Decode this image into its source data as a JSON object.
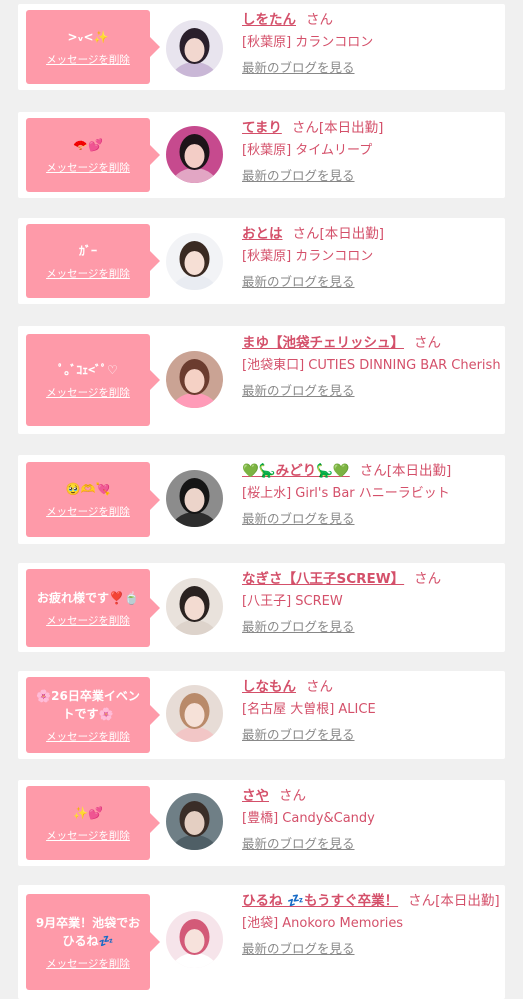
{
  "delete_label": "メッセージを削除",
  "blog_label": "最新のブログを見る",
  "colors": {
    "bubble": "#fe9aa9",
    "accent": "#d4506a",
    "background": "#f0f0f0"
  },
  "cards": [
    {
      "message": ">ᵥ<✨",
      "name": "しをたん",
      "suffix": "さん",
      "shop": "[秋葉原] カランコロン",
      "avatar": {
        "bg": "#e8e4ee",
        "hair": "#2a1f2b",
        "skin": "#f2d7cf",
        "cloth": "#c9b7d6"
      }
    },
    {
      "message": "🪭💕",
      "name": "てまり",
      "suffix": "さん[本日出勤]",
      "shop": "[秋葉原] タイムリープ",
      "avatar": {
        "bg": "#c64a8e",
        "hair": "#1d1419",
        "skin": "#f3cdc6",
        "cloth": "#e2a6c4"
      }
    },
    {
      "message": "ｶﾞｰ",
      "name": "おとは",
      "suffix": "さん[本日出勤]",
      "shop": "[秋葉原] カランコロン",
      "avatar": {
        "bg": "#f2f3f6",
        "hair": "#3a2a22",
        "skin": "#f6dfd5",
        "cloth": "#e9ecf2"
      }
    },
    {
      "message": "ﾟ｡ﾞｺｪ<ﾞﾟ♡",
      "name": "まゆ【池袋チェリッシュ】",
      "suffix": "さん",
      "shop": "[池袋東口] CUTIES DINNING BAR Cherish",
      "avatar": {
        "bg": "#caa394",
        "hair": "#6b3c2f",
        "skin": "#f5d1c5",
        "cloth": "#ff9bb8"
      }
    },
    {
      "message": "🥹🫶💘",
      "name": "💚🦕みどり🦕💚",
      "suffix": "さん[本日出勤]",
      "shop": "[桜上水] Girl's Bar ハニーラビット",
      "avatar": {
        "bg": "#8c8c8c",
        "hair": "#151515",
        "skin": "#ecd4ca",
        "cloth": "#2d2d2d"
      }
    },
    {
      "message": "お疲れ様です❣️🍵",
      "name": "なぎさ【八王子SCREW】",
      "suffix": "さん",
      "shop": "[八王子] SCREW",
      "avatar": {
        "bg": "#e9e2dc",
        "hair": "#2a2220",
        "skin": "#f3dbd1",
        "cloth": "#ddd3cb"
      }
    },
    {
      "message": "🌸26日卒業イベントです🌸",
      "name": "しなもん",
      "suffix": "さん",
      "shop": "[名古屋 大曽根] ALICE",
      "avatar": {
        "bg": "#e7dcd6",
        "hair": "#b98a6a",
        "skin": "#f6e1d8",
        "cloth": "#f2c6c6"
      }
    },
    {
      "message": "✨💕",
      "name": "さや",
      "suffix": "さん",
      "shop": "[豊橋] Candy&Candy",
      "avatar": {
        "bg": "#6f7f86",
        "hair": "#3a2e28",
        "skin": "#e4cfc2",
        "cloth": "#4f5f66"
      }
    },
    {
      "message": "9月卒業！池袋でおひるね💤",
      "name": "ひるね 💤もうすぐ卒業！",
      "suffix": "さん[本日出勤]",
      "shop": "[池袋] Anokoro Memories",
      "avatar": {
        "bg": "#f6e4ea",
        "hair": "#d35a78",
        "skin": "#f7e2dc",
        "cloth": "#ffffff"
      }
    }
  ]
}
